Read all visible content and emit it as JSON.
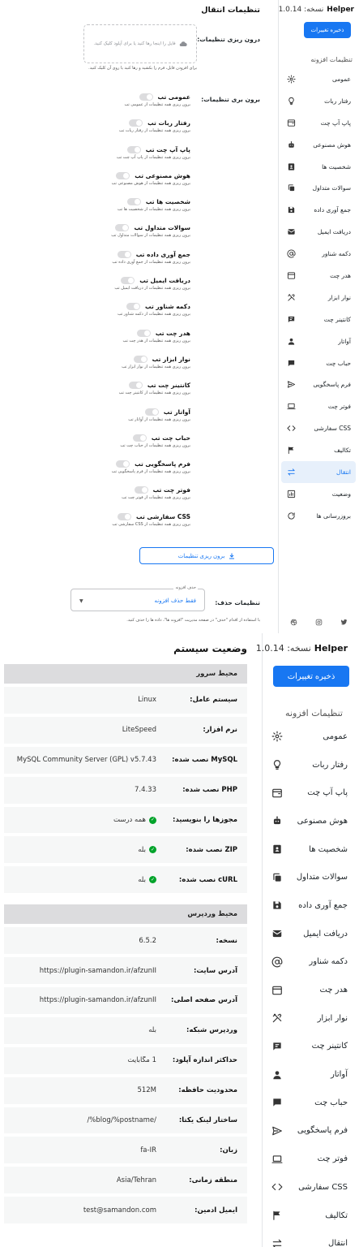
{
  "brand": {
    "name": "Helper",
    "version_label": "نسخه: 1.0.14"
  },
  "sidebar": {
    "save_button": "ذخیره تغییرات",
    "section_title": "تنظیمات افزونه",
    "items": [
      {
        "label": "عمومی",
        "icon": "gear-icon"
      },
      {
        "label": "رفتار ربات",
        "icon": "bulb-icon"
      },
      {
        "label": "پاپ آپ چت",
        "icon": "popup-window-icon"
      },
      {
        "label": "هوش مصنوعی",
        "icon": "robot-icon"
      },
      {
        "label": "شخصیت ها",
        "icon": "id-card-icon"
      },
      {
        "label": "سوالات متداول",
        "icon": "copy-icon"
      },
      {
        "label": "جمع آوری داده",
        "icon": "floppy-disk-icon"
      },
      {
        "label": "دریافت ایمیل",
        "icon": "envelope-icon"
      },
      {
        "label": "دکمه شناور",
        "icon": "at-sign-icon"
      },
      {
        "label": "هدر چت",
        "icon": "browser-window-icon"
      },
      {
        "label": "نوار ابزار",
        "icon": "tools-icon"
      },
      {
        "label": "کانتینر چت",
        "icon": "chat-lines-icon"
      },
      {
        "label": "آواتار",
        "icon": "user-icon"
      },
      {
        "label": "حباب چت",
        "icon": "chat-bubble-icon"
      },
      {
        "label": "فرم پاسخگویی",
        "icon": "send-icon"
      },
      {
        "label": "فوتر چت",
        "icon": "laptop-icon"
      },
      {
        "label": "CSS سفارشی",
        "icon": "code-icon"
      },
      {
        "label": "تکالیف",
        "icon": "flag-icon"
      },
      {
        "label": "انتقال",
        "icon": "transfer-arrows-icon"
      },
      {
        "label": "وضعیت",
        "icon": "chart-box-icon"
      },
      {
        "label": "بروزرسانی ها",
        "icon": "refresh-icon"
      }
    ],
    "active_index": 18
  },
  "transfer": {
    "title": "تنظیمات انتقال",
    "import_label": "درون ریزی تنظیمات:",
    "dropzone_text": "فایل را اینجا رها کنید یا برای آپلود کلیک کنید.",
    "drop_hint": "برای افزودن فایل، فرم را بکشید و رها کنید یا روی آن کلیک کنید.",
    "export_label": "برون بری تنظیمات:",
    "export_items": [
      {
        "title": "عمومی تب",
        "desc": "برون ریزی همه تنظیمات از عمومی تب"
      },
      {
        "title": "رفتار ربات تب",
        "desc": "برون ریزی همه تنظیمات از رفتار ربات تب"
      },
      {
        "title": "پاپ آپ چت تب",
        "desc": "برون ریزی همه تنظیمات از پاپ آپ چت تب"
      },
      {
        "title": "هوش مصنوعی تب",
        "desc": "برون ریزی همه تنظیمات از هوش مصنوعی تب"
      },
      {
        "title": "شخصیت ها تب",
        "desc": "برون ریزی همه تنظیمات از شخصیت ها تب"
      },
      {
        "title": "سوالات متداول تب",
        "desc": "برون ریزی همه تنظیمات از سوالات متداول تب"
      },
      {
        "title": "جمع آوری داده تب",
        "desc": "برون ریزی همه تنظیمات از جمع آوری داده تب"
      },
      {
        "title": "دریافت ایمیل تب",
        "desc": "برون ریزی همه تنظیمات از دریافت ایمیل تب"
      },
      {
        "title": "دکمه شناور تب",
        "desc": "برون ریزی همه تنظیمات از دکمه شناور تب"
      },
      {
        "title": "هدر چت تب",
        "desc": "برون ریزی همه تنظیمات از هدر چت تب"
      },
      {
        "title": "نوار ابزار تب",
        "desc": "برون ریزی همه تنظیمات از نوار ابزار تب"
      },
      {
        "title": "کانتینر چت تب",
        "desc": "برون ریزی همه تنظیمات از کانتینر چت تب"
      },
      {
        "title": "آواتار تب",
        "desc": "برون ریزی همه تنظیمات از آواتار تب"
      },
      {
        "title": "حباب چت تب",
        "desc": "برون ریزی همه تنظیمات از حباب چت تب"
      },
      {
        "title": "فرم پاسخگویی تب",
        "desc": "برون ریزی همه تنظیمات از فرم پاسخگویی تب"
      },
      {
        "title": "فوتر چت تب",
        "desc": "برون ریزی همه تنظیمات از فوتر چت تب"
      },
      {
        "title": "CSS سفارشی تب",
        "desc": "برون ریزی همه تنظیمات از CSS سفارشی تب"
      }
    ],
    "export_button": "برون ریزی تنظیمات",
    "delete_label": "تنظیمات حذف:",
    "delete_legend": "حذف افزونه",
    "delete_value": "فقط حذف افزونه",
    "delete_note": "با استفاده از اقدام \"حذف\" در صفحه مدیریت \"افزونه ها\"، داده ها را حذف کنید."
  },
  "status": {
    "title": "وضعیت سیستم",
    "server_header": "محیط سرور",
    "server_rows": [
      {
        "label": "سیستم عامل:",
        "value": "Linux",
        "check": false
      },
      {
        "label": "نرم افزار:",
        "value": "LiteSpeed",
        "check": false
      },
      {
        "label": "MySQL نصب شده:",
        "value": "MySQL Community Server (GPL) v5.7.43",
        "check": false
      },
      {
        "label": "PHP نصب شده:",
        "value": "7.4.33",
        "check": false
      },
      {
        "label": "مجوزها را بنویسید:",
        "value": "همه درست",
        "check": true
      },
      {
        "label": "ZIP نصب شده:",
        "value": "بله",
        "check": true
      },
      {
        "label": "cURL نصب شده:",
        "value": "بله",
        "check": true
      }
    ],
    "wp_header": "محیط وردپرس",
    "wp_rows": [
      {
        "label": "نسخه:",
        "value": "6.5.2",
        "check": false
      },
      {
        "label": "آدرس سایت:",
        "value": "https://plugin-samandon.ir/afzunII",
        "check": false
      },
      {
        "label": "آدرس صفحه اصلی:",
        "value": "https://plugin-samandon.ir/afzunII",
        "check": false
      },
      {
        "label": "وردپرس شبکه:",
        "value": "بله",
        "check": false
      },
      {
        "label": "حداکثر اندازه آپلود:",
        "value": "1 مگابایت",
        "check": false
      },
      {
        "label": "محدودیت حافظه:",
        "value": "512M",
        "check": false
      },
      {
        "label": "ساختار لینک یکتا:",
        "value": "/%blog/%postname/",
        "check": false
      },
      {
        "label": "زبان:",
        "value": "fa-IR",
        "check": false
      },
      {
        "label": "منطقه زمانی:",
        "value": "Asia/Tehran",
        "check": false
      },
      {
        "label": "ایمیل ادمین:",
        "value": "test@samandon.com",
        "check": false
      }
    ]
  },
  "social_icons": [
    "twitter-icon",
    "instagram-icon",
    "dribbble-icon"
  ],
  "colors": {
    "accent": "#1877f2",
    "success": "#00a32a",
    "header_bg": "#dcdcde",
    "row_bg": "#f6f7f7"
  }
}
